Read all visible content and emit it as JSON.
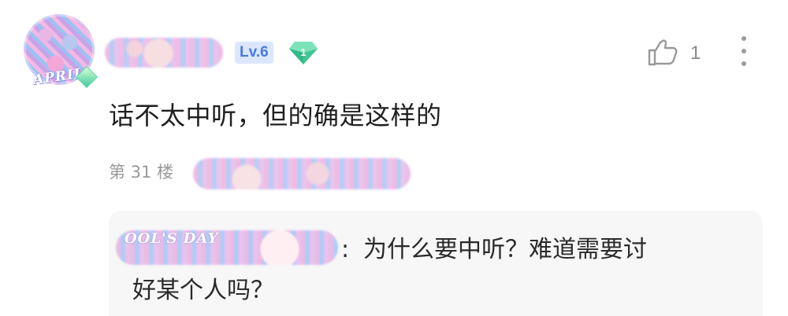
{
  "avatar": {
    "badge_text": "APRIL",
    "icon": "avatar"
  },
  "user": {
    "level": "Lv.6",
    "gem_count": "1"
  },
  "actions": {
    "like_count": "1",
    "like_icon": "thumbs-up-icon",
    "more_icon": "more-vertical-icon"
  },
  "comment": {
    "text": "话不太中听，但的确是这样的",
    "floor": "第 31 楼"
  },
  "reply": {
    "name_overlay": "OOL'S DAY",
    "colon": ":",
    "line1": "为什么要中听？难道需要讨",
    "line2": "好某个人吗？"
  },
  "colors": {
    "level_bg": "#dce7ff",
    "level_text": "#4878ea",
    "gem": "#45c99c",
    "reply_bg": "#f7f7f7",
    "text": "#1f1f1f",
    "meta": "#9a9a9a"
  }
}
